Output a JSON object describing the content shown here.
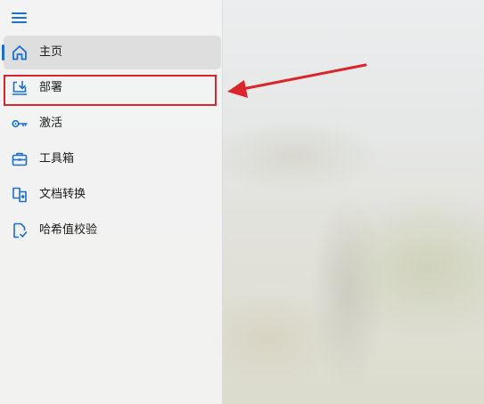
{
  "nav": {
    "items": [
      {
        "label": "主页",
        "icon": "home-icon",
        "selected": true
      },
      {
        "label": "部署",
        "icon": "deploy-icon",
        "selected": false
      },
      {
        "label": "激活",
        "icon": "key-icon",
        "selected": false
      },
      {
        "label": "工具箱",
        "icon": "toolbox-icon",
        "selected": false
      },
      {
        "label": "文档转换",
        "icon": "document-convert-icon",
        "selected": false
      },
      {
        "label": "哈希值校验",
        "icon": "hash-check-icon",
        "selected": false
      }
    ]
  },
  "colors": {
    "accent": "#1a6fd1",
    "annotation": "#d9252b",
    "selected_bg": "#dedede"
  },
  "annotation": {
    "highlighted_item": "部署",
    "type": "red-box-and-arrow"
  }
}
